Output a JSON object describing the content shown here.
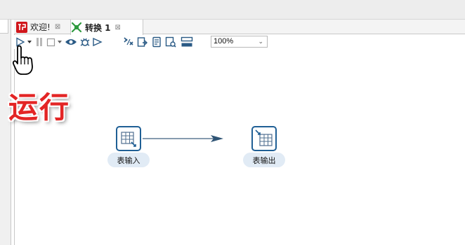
{
  "tabs": [
    {
      "label": "欢迎!",
      "icon": "pdi-logo-icon",
      "active": false
    },
    {
      "label": "转换 1",
      "icon": "transformation-icon",
      "active": true
    }
  ],
  "toolbar": {
    "buttons": [
      "run-icon",
      "run-options-icon",
      "pause-icon",
      "stop-icon",
      "stop-options-icon",
      "preview-icon",
      "debug-icon",
      "replay-icon",
      "verify-icon",
      "impact-icon",
      "sql-icon",
      "explore-db-icon",
      "show-results-icon"
    ],
    "zoom": "100%"
  },
  "annotation": "运行",
  "canvas": {
    "steps": [
      {
        "id": "table-input",
        "label": "表输入"
      },
      {
        "id": "table-output",
        "label": "表输出"
      }
    ],
    "hops": [
      {
        "from": "table-input",
        "to": "table-output"
      }
    ]
  },
  "colors": {
    "step_border": "#1f5f95",
    "step_label_bg": "#e1ebf5",
    "hop": "#3f5f7f",
    "annotation": "#e32525",
    "active_tab_icon": "#2e9a3e"
  }
}
